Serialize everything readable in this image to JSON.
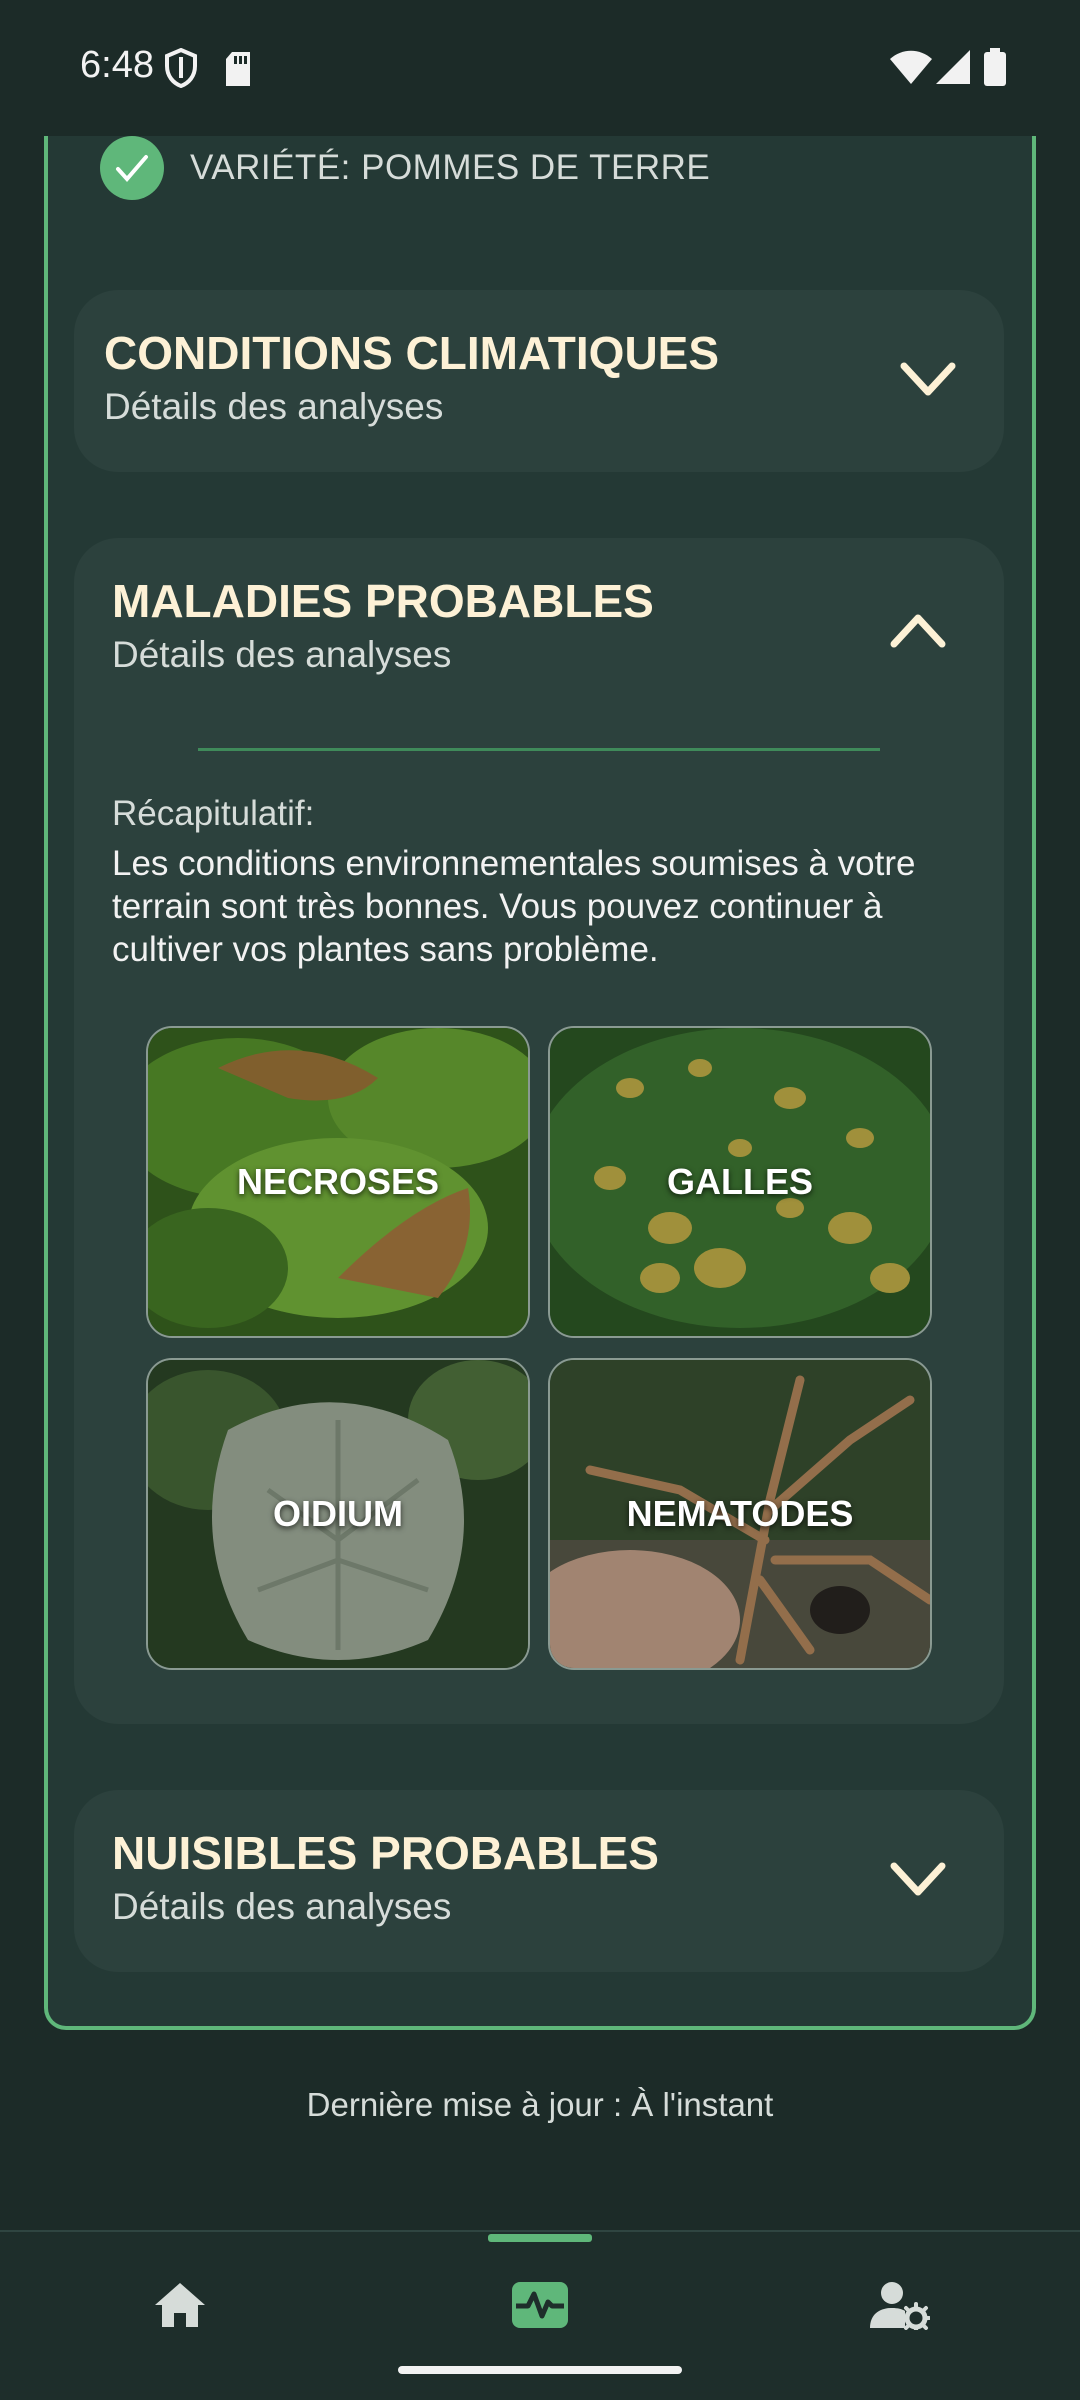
{
  "status_bar": {
    "time": "6:48",
    "icons": [
      "shield-icon",
      "sd-card-icon",
      "wifi-icon",
      "cell-signal-icon",
      "battery-icon"
    ]
  },
  "variety": {
    "label": "VARIÉTÉ: POMMES DE TERRE",
    "icon": "check-circle-icon"
  },
  "sections": {
    "climate": {
      "title": "CONDITIONS CLIMATIQUES",
      "subtitle": "Détails des analyses",
      "expanded": false
    },
    "diseases": {
      "title": "MALADIES PROBABLES",
      "subtitle": "Détails des analyses",
      "expanded": true,
      "recap_label": "Récapitulatif:",
      "recap_text": "Les conditions environnementales soumises à votre terrain sont très bonnes. Vous pouvez continuer à cultiver vos plantes sans problème.",
      "tiles": [
        {
          "label": "NECROSES",
          "image": "wilted-leaf-photo"
        },
        {
          "label": "GALLES",
          "image": "leaf-galls-photo"
        },
        {
          "label": "OIDIUM",
          "image": "powdery-mildew-photo"
        },
        {
          "label": "NEMATODES",
          "image": "infested-roots-photo"
        }
      ]
    },
    "pests": {
      "title": "NUISIBLES PROBABLES",
      "subtitle": "Détails des analyses",
      "expanded": false
    }
  },
  "last_update": "Dernière mise à jour :  À l'instant",
  "bottom_nav": {
    "items": [
      {
        "name": "home",
        "icon": "home-icon",
        "active": false
      },
      {
        "name": "analysis",
        "icon": "pulse-monitor-icon",
        "active": true
      },
      {
        "name": "account",
        "icon": "user-settings-icon",
        "active": false
      }
    ]
  },
  "colors": {
    "background": "#1c2b28",
    "card": "#243935",
    "section": "#2c413d",
    "accent": "#5fb77a",
    "title_text": "#fdf1d6"
  }
}
